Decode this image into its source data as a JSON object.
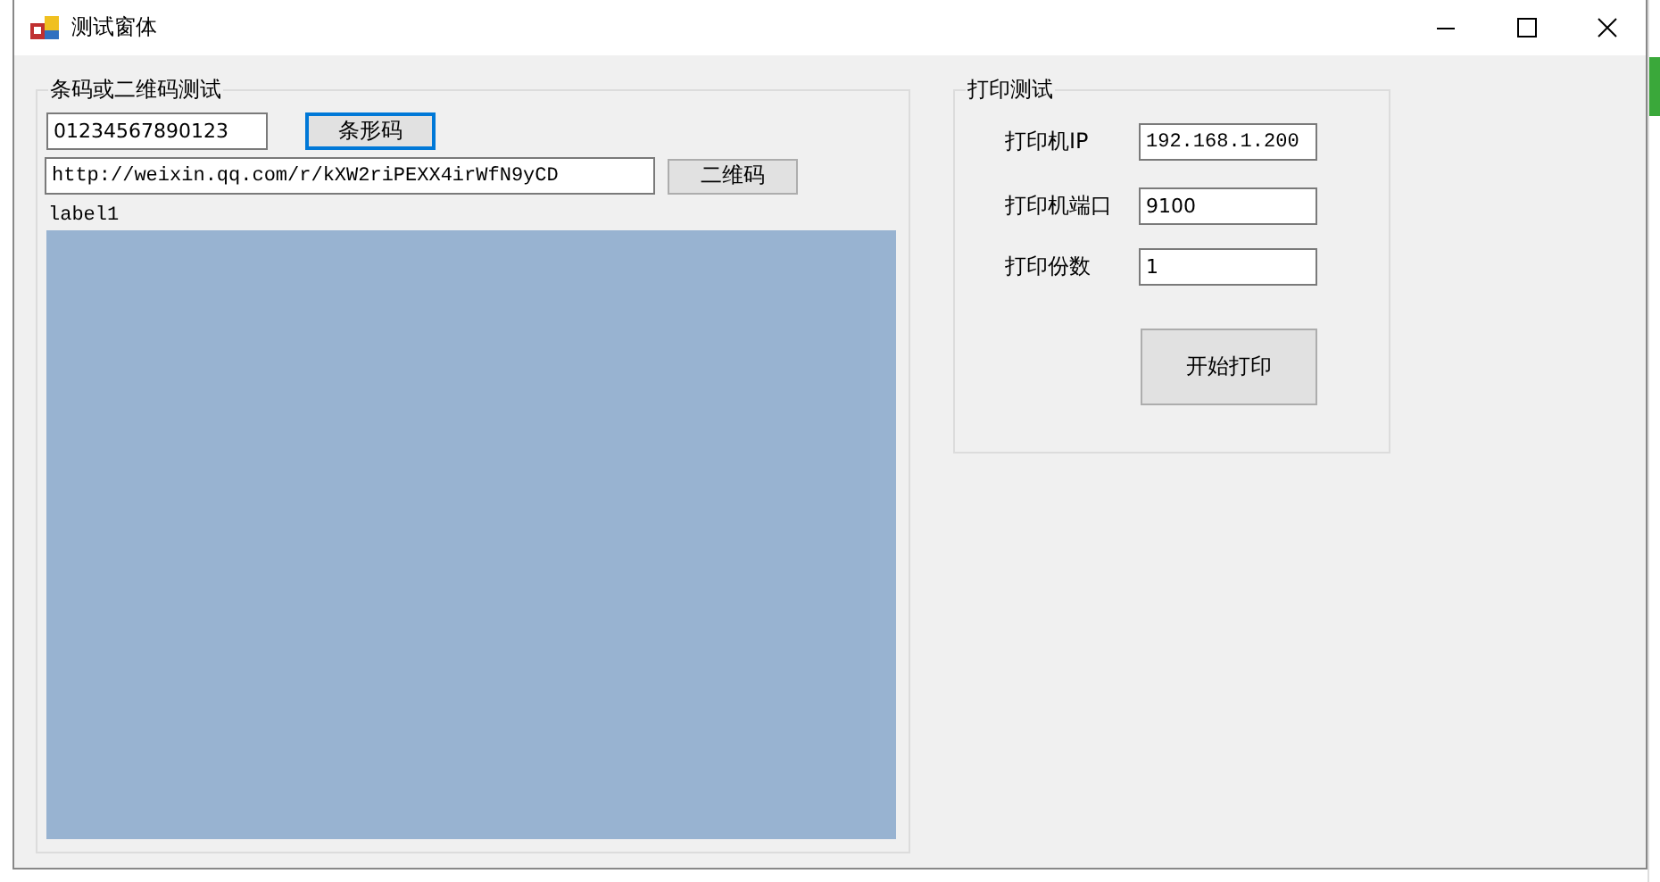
{
  "window": {
    "title": "测试窗体"
  },
  "barcode_group": {
    "title": "条码或二维码测试",
    "barcode_input": {
      "value": "01234567890123"
    },
    "barcode_button": {
      "label": "条形码",
      "focused": true
    },
    "qr_input": {
      "value": "http://weixin.qq.com/r/kXW2riPEXX4irWfN9yCD"
    },
    "qr_button": {
      "label": "二维码",
      "focused": false
    },
    "image_label": "label1"
  },
  "print_group": {
    "title": "打印测试",
    "fields": [
      {
        "label": "打印机IP",
        "value": "192.168.1.200"
      },
      {
        "label": "打印机端口",
        "value": "9100"
      },
      {
        "label": "打印份数",
        "value": "1"
      }
    ],
    "print_button": {
      "label": "开始打印"
    }
  }
}
